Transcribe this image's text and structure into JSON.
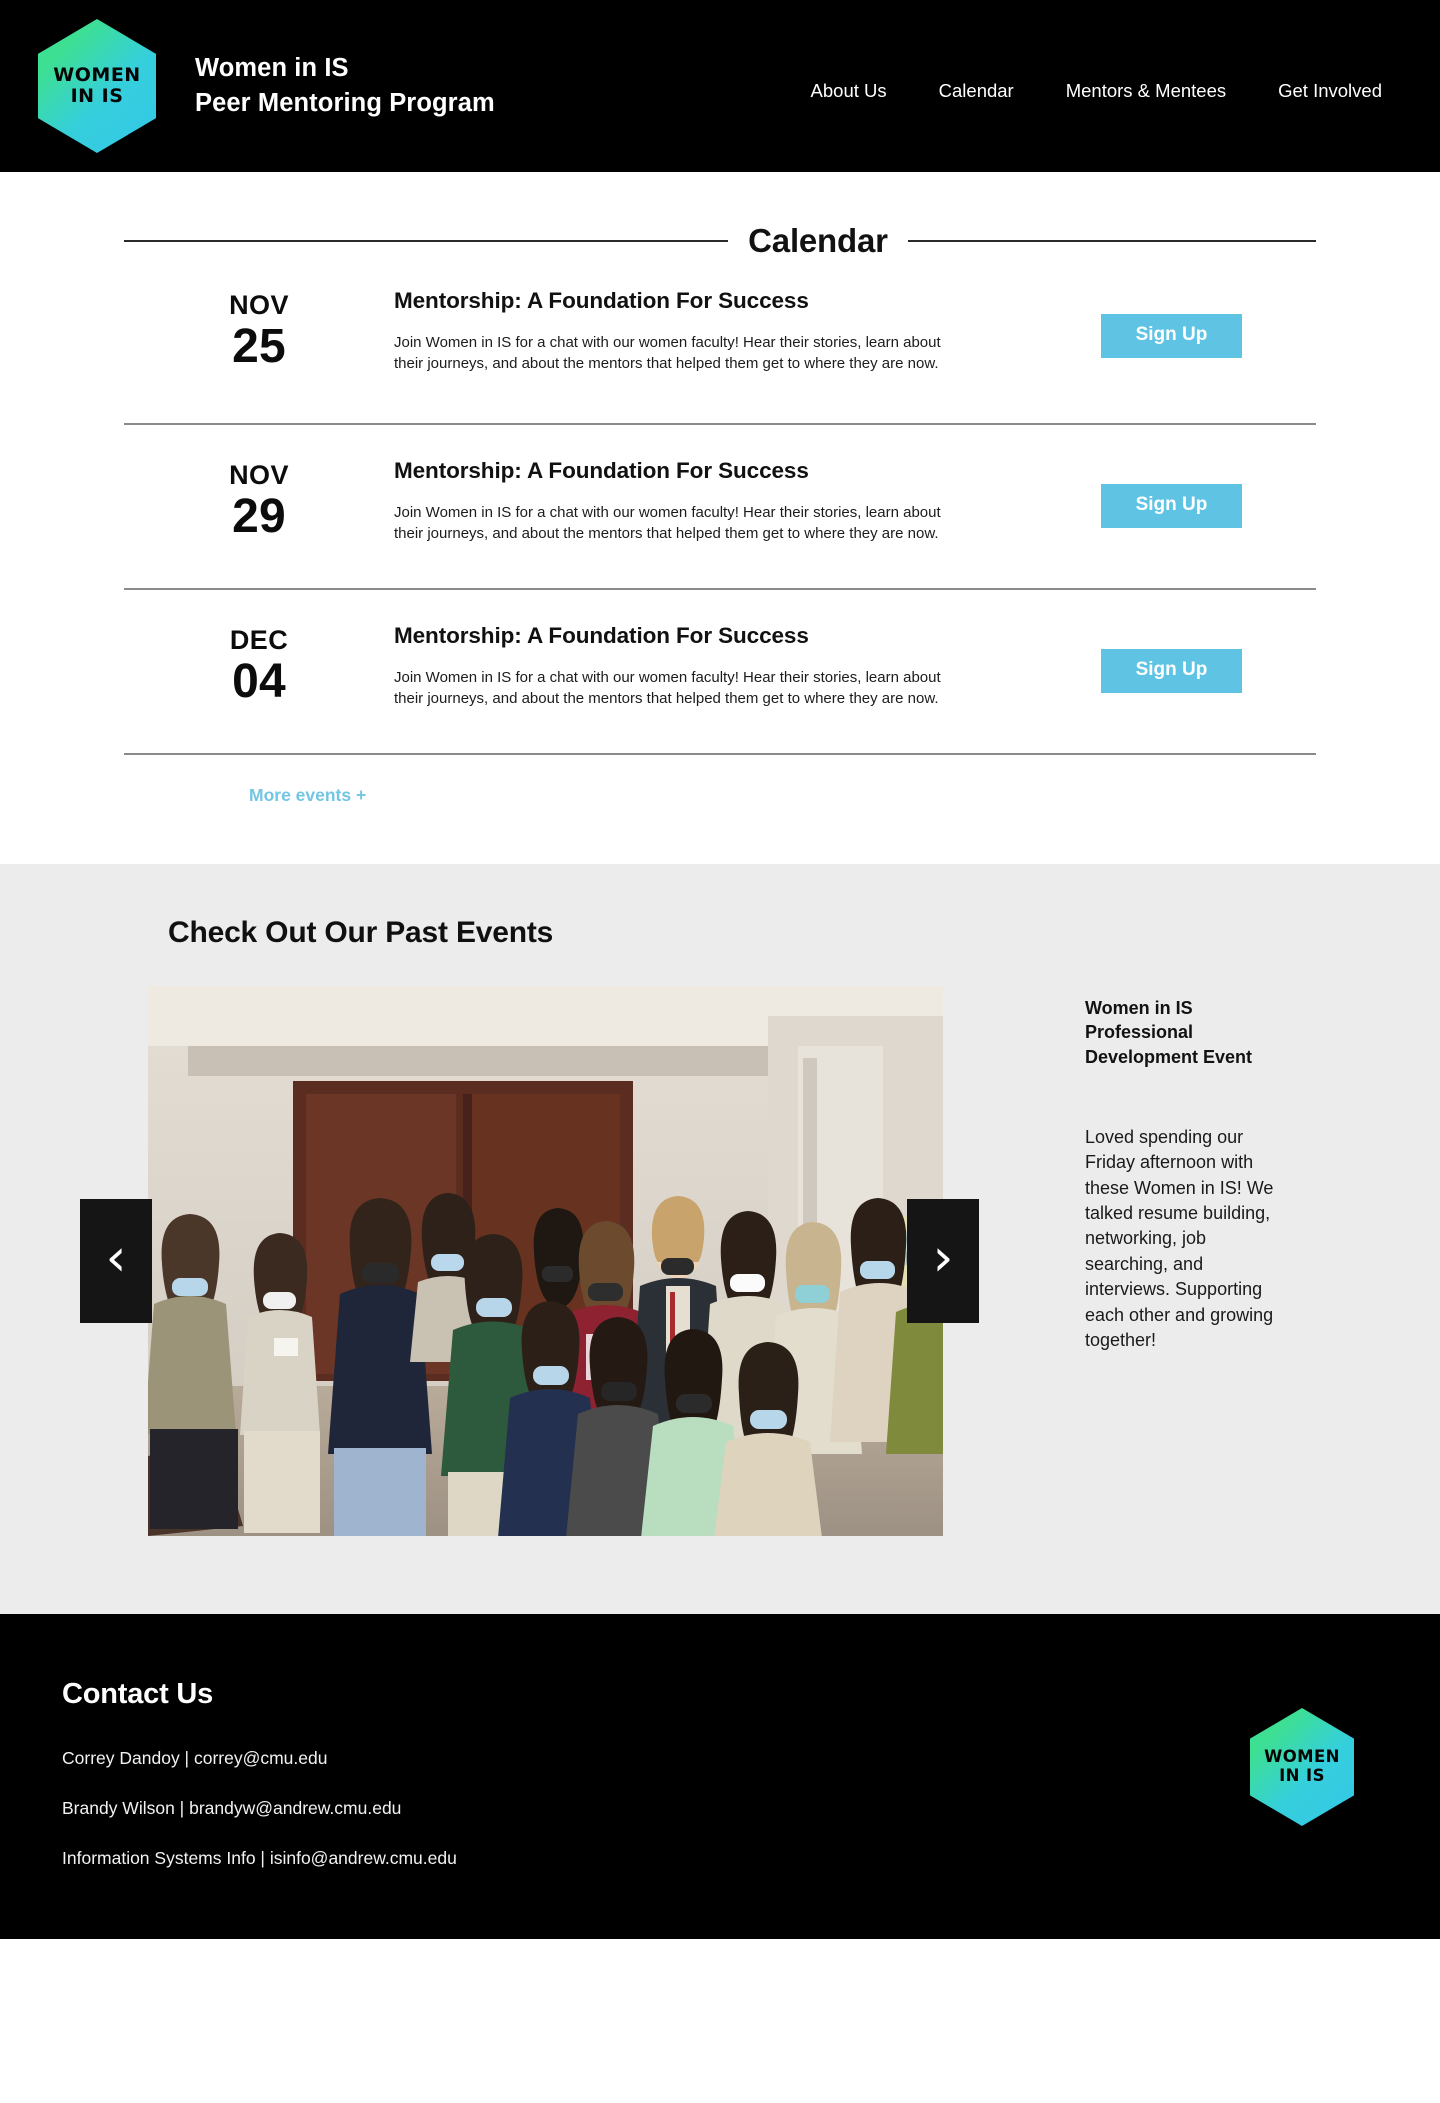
{
  "header": {
    "logo": {
      "line1": "WOMEN",
      "line2": "IN IS",
      "gradient_from": "#3ee58f",
      "gradient_to": "#35c7e8"
    },
    "title_line1": "Women in IS",
    "title_line2": "Peer Mentoring Program",
    "background": "#000000",
    "nav": [
      {
        "label": "About Us"
      },
      {
        "label": "Calendar"
      },
      {
        "label": "Mentors & Mentees"
      },
      {
        "label": "Get Involved"
      }
    ]
  },
  "calendar": {
    "title": "Calendar",
    "events": [
      {
        "month": "NOV",
        "day": "25",
        "title": "Mentorship: A Foundation For Success",
        "description": "Join Women in IS for a chat with our women faculty! Hear their stories, learn about their journeys, and about the mentors that helped them get to where they are now.",
        "button": "Sign Up"
      },
      {
        "month": "NOV",
        "day": "29",
        "title": "Mentorship: A Foundation For Success",
        "description": "Join Women in IS for a chat with our women faculty! Hear their stories, learn about their journeys, and about the mentors that helped them get to where they are now.",
        "button": "Sign Up"
      },
      {
        "month": "DEC",
        "day": "04",
        "title": "Mentorship: A Foundation For Success",
        "description": "Join Women in IS for a chat with our women faculty! Hear their stories, learn about their journeys, and about the mentors that helped them get to where they are now.",
        "button": "Sign Up"
      }
    ],
    "more_events_label": "More events +",
    "accent_color": "#5fc3e4",
    "link_color": "#73c6e3"
  },
  "past_events": {
    "section_title": "Check Out Our Past Events",
    "background": "#ececec",
    "prev_arrow": "‹",
    "next_arrow": "›",
    "slide": {
      "caption_title": "Women in IS Professional Development Event",
      "caption_body": "Loved spending our Friday afternoon with these Women in IS! We talked resume building, networking, job searching, and interviews. Supporting each other and growing together!",
      "photo_alt": "Group photo of Women in IS members wearing face masks in a classroom"
    }
  },
  "footer": {
    "title": "Contact Us",
    "background": "#000000",
    "contacts": [
      {
        "line": "Correy Dandoy | correy@cmu.edu"
      },
      {
        "line": "Brandy Wilson | brandyw@andrew.cmu.edu"
      },
      {
        "line": "Information Systems Info | isinfo@andrew.cmu.edu"
      }
    ],
    "logo": {
      "line1": "WOMEN",
      "line2": "IN IS"
    }
  }
}
